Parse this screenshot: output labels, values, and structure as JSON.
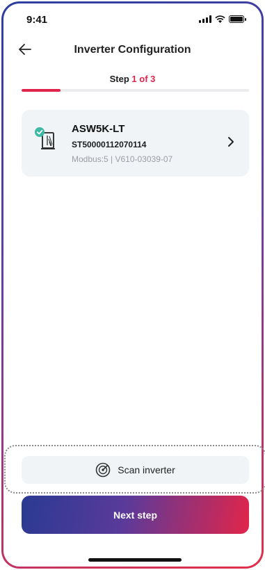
{
  "status_bar": {
    "time": "9:41",
    "icons": [
      "signal-icon",
      "wifi-icon",
      "battery-icon"
    ]
  },
  "header": {
    "back_icon": "back-arrow-icon",
    "title": "Inverter Configuration"
  },
  "stepper": {
    "prefix": "Step",
    "current": "1 of 3",
    "progress": 0.17,
    "accent_color": "#e0254c"
  },
  "device": {
    "icon": "inverter-connected-icon",
    "name": "ASW5K-LT",
    "serial": "ST50000112070114",
    "meta": "Modbus:5 | V610-03039-07",
    "chevron": "chevron-right-icon"
  },
  "scan": {
    "icon": "scan-radar-icon",
    "label": "Scan inverter"
  },
  "next": {
    "label": "Next step"
  },
  "colors": {
    "gradient_start": "#2a3a92",
    "gradient_end": "#e1254a",
    "card_bg": "#f1f4f6",
    "check_green": "#3fb8a6"
  }
}
